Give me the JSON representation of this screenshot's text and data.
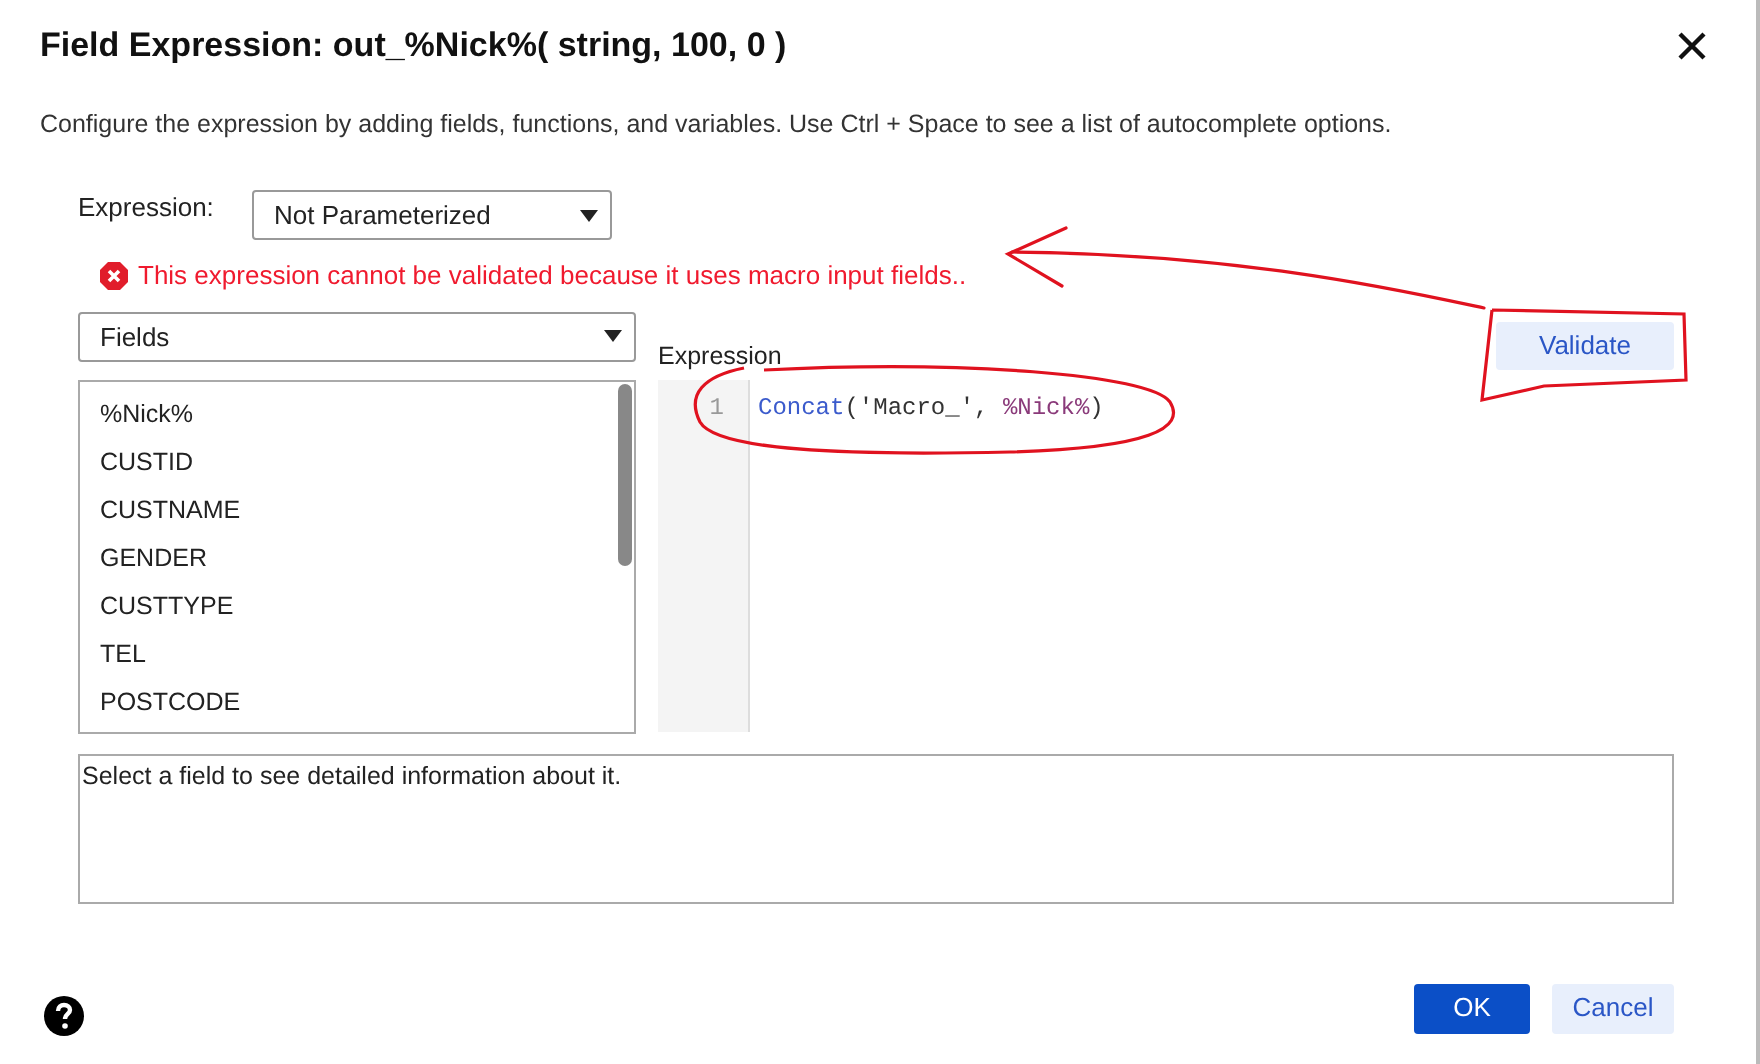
{
  "dialog": {
    "title": "Field Expression: out_%Nick%( string, 100, 0 )",
    "description": "Configure the expression by adding fields, functions, and variables. Use Ctrl + Space to see a list of autocomplete options."
  },
  "expression_mode": {
    "label": "Expression:",
    "value": "Not Parameterized"
  },
  "error": "This expression cannot be validated because it uses macro input fields..",
  "source_select": {
    "value": "Fields"
  },
  "fields": [
    "%Nick%",
    "CUSTID",
    "CUSTNAME",
    "GENDER",
    "CUSTTYPE",
    "TEL",
    "POSTCODE"
  ],
  "editor": {
    "label": "Expression",
    "validate_button": "Validate",
    "lines": [
      {
        "number": "1",
        "tokens": [
          {
            "text": "Concat",
            "kind": "function"
          },
          {
            "text": "('Macro_', ",
            "kind": "plain"
          },
          {
            "text": "%Nick%",
            "kind": "variable"
          },
          {
            "text": ")",
            "kind": "plain"
          }
        ]
      }
    ]
  },
  "info": "Select a field to see detailed information about it.",
  "buttons": [
    {
      "label": "OK",
      "kind": "primary"
    },
    {
      "label": "Cancel",
      "kind": "secondary"
    }
  ]
}
